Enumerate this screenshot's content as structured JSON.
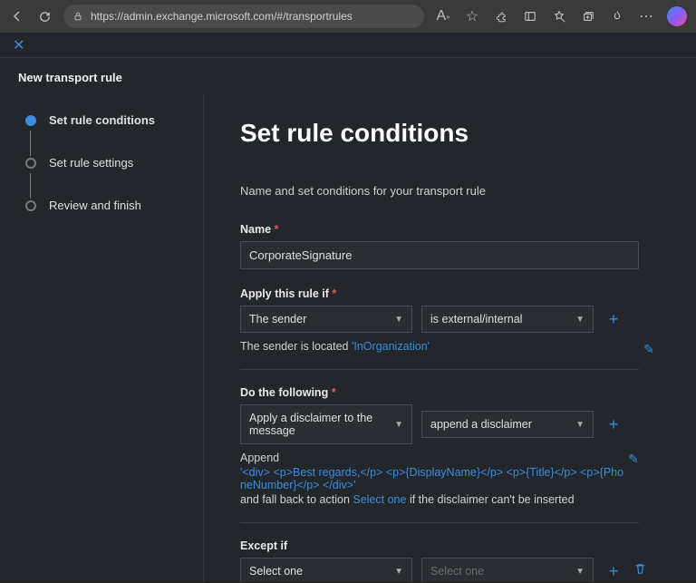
{
  "browser": {
    "url": "https://admin.exchange.microsoft.com/#/transportrules"
  },
  "panel": {
    "title": "New transport rule"
  },
  "steps": [
    {
      "label": "Set rule conditions",
      "active": true
    },
    {
      "label": "Set rule settings",
      "active": false
    },
    {
      "label": "Review and finish",
      "active": false
    }
  ],
  "main": {
    "heading": "Set rule conditions",
    "subtitle": "Name and set conditions for your transport rule",
    "name": {
      "label": "Name",
      "value": "CorporateSignature"
    },
    "apply_if": {
      "label": "Apply this rule if",
      "select1": "The sender",
      "select2": "is external/internal",
      "summary_pre": "The sender is located ",
      "summary_link": "'InOrganization'"
    },
    "do_following": {
      "label": "Do the following",
      "select1": "Apply a disclaimer to the message",
      "select2": "append a disclaimer",
      "append_label": "Append",
      "disclaimer": "'<div> <p>Best regards,</p> <p>{DisplayName}</p> <p>{Title}</p> <p>{PhoneNumber}</p> </div>'",
      "fallback_pre": " and fall back to action ",
      "fallback_link": "Select one",
      "fallback_post": " if the disclaimer can't be inserted"
    },
    "except_if": {
      "label": "Except if",
      "select1": "Select one",
      "select2_placeholder": "Select one"
    }
  }
}
